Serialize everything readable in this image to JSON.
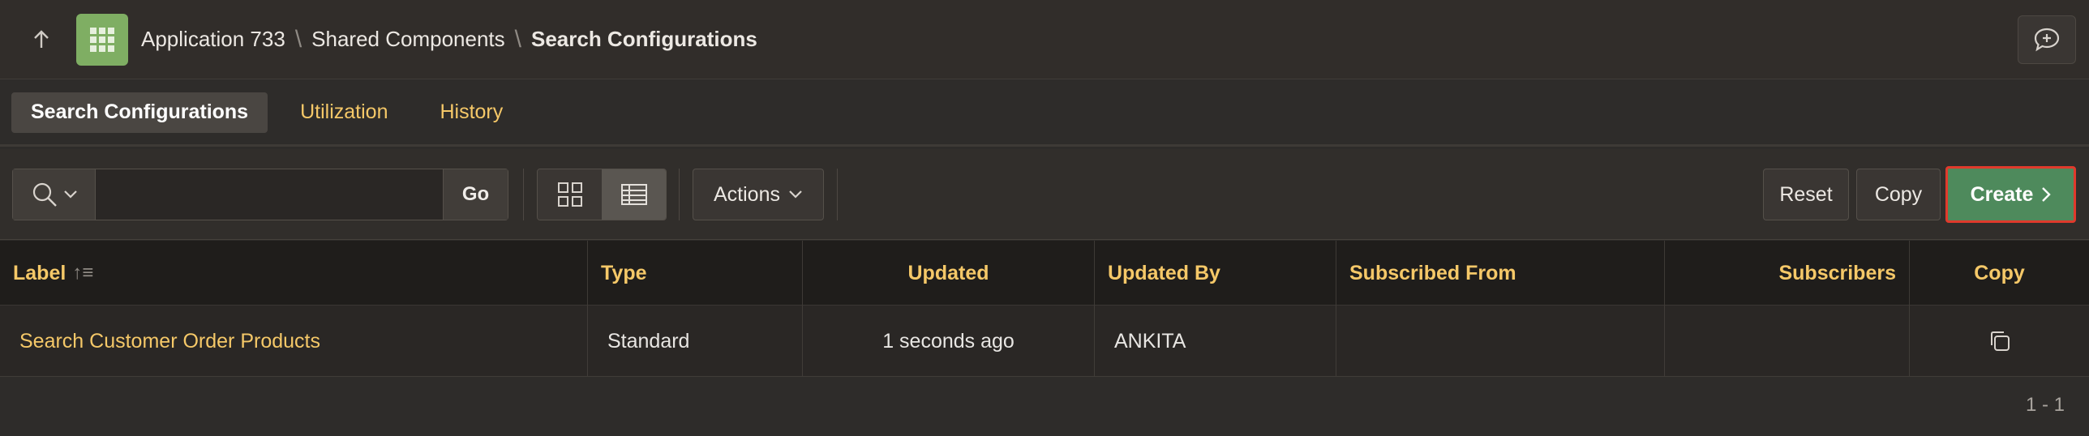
{
  "header": {
    "breadcrumbs": [
      {
        "label": "Application 733"
      },
      {
        "label": "Shared Components"
      },
      {
        "label": "Search Configurations"
      }
    ]
  },
  "tabs": [
    {
      "label": "Search Configurations",
      "active": true
    },
    {
      "label": "Utilization",
      "active": false
    },
    {
      "label": "History",
      "active": false
    }
  ],
  "toolbar": {
    "search_value": "",
    "go_label": "Go",
    "actions_label": "Actions",
    "reset_label": "Reset",
    "copy_label": "Copy",
    "create_label": "Create"
  },
  "table": {
    "columns": [
      "Label",
      "Type",
      "Updated",
      "Updated By",
      "Subscribed From",
      "Subscribers",
      "Copy"
    ],
    "rows": [
      {
        "label": "Search Customer Order Products",
        "type": "Standard",
        "updated": "1 seconds ago",
        "updated_by": "ANKITA",
        "subscribed_from": "",
        "subscribers": ""
      }
    ]
  },
  "pagination": "1 - 1",
  "colors": {
    "accent": "#f5c868",
    "create_button": "#4e8a5c",
    "highlight_border": "#e03a2c",
    "app_icon": "#7fae63"
  }
}
